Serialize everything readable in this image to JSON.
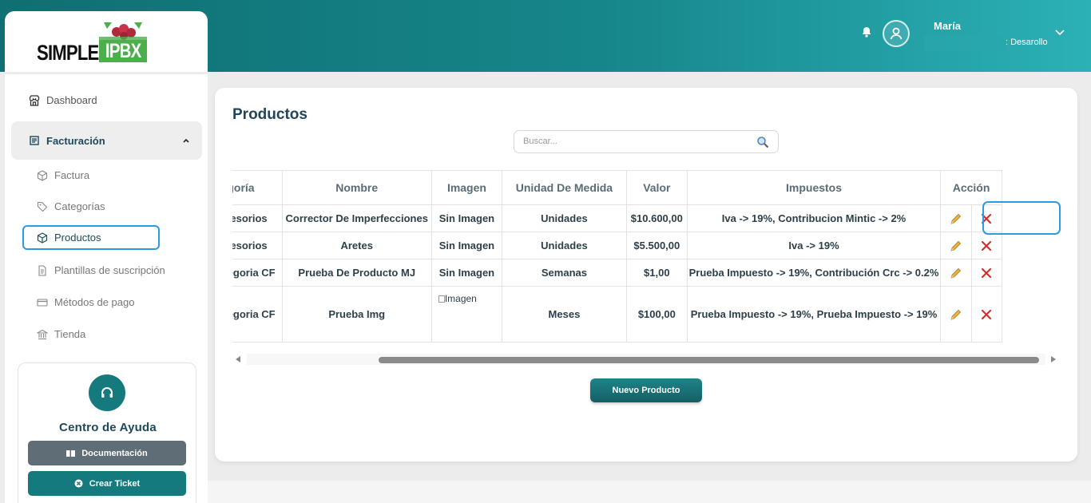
{
  "header": {
    "user_name": "María",
    "user_role": ": Desarollo"
  },
  "sidebar": {
    "logo_simple": "SIMPLE",
    "logo_ipbx": "IPBX",
    "dashboard": "Dashboard",
    "facturacion": "Facturación",
    "sub_items": {
      "factura": "Factura",
      "categorias": "Categorías",
      "productos": "Productos",
      "plantillas": "Plantillas de suscripción",
      "metodos": "Métodos de pago",
      "tienda": "Tienda"
    },
    "help": {
      "title": "Centro de Ayuda",
      "documentacion": "Documentación",
      "crear_ticket": "Crear Ticket"
    }
  },
  "main": {
    "title": "Productos",
    "search_placeholder": "Buscar...",
    "columns": [
      "Categoría",
      "Nombre",
      "Imagen",
      "Unidad De Medida",
      "Valor",
      "Impuestos",
      "Acción"
    ],
    "rows": [
      {
        "categoria": "Accesorios",
        "nombre": "Corrector De Imperfecciones",
        "imagen": "Sin Imagen",
        "unidad": "Unidades",
        "valor": "$10.600,00",
        "impuestos": "Iva -> 19%, Contribucion Mintic -> 2%"
      },
      {
        "categoria": "Accesorios",
        "nombre": "Aretes",
        "imagen": "Sin Imagen",
        "unidad": "Unidades",
        "valor": "$5.500,00",
        "impuestos": "Iva -> 19%"
      },
      {
        "categoria": "Categoria CF",
        "nombre": "Prueba De Producto MJ",
        "imagen": "Sin Imagen",
        "unidad": "Semanas",
        "valor": "$1,00",
        "impuestos": "Prueba Impuesto -> 19%, Contribución Crc -> 0.2%"
      },
      {
        "categoria": "Categoria CF",
        "nombre": "Prueba Img",
        "imagen": "Imagen",
        "unidad": "Meses",
        "valor": "$100,00",
        "impuestos": "Prueba Impuesto -> 19%, Prueba Impuesto -> 19%"
      }
    ],
    "new_button": "Nuevo Producto"
  },
  "colors": {
    "accent": "#157a7d",
    "highlight": "#2d9be0",
    "delete": "#d0312d"
  },
  "icons": {
    "edit": "pencil-icon",
    "delete": "close-icon"
  }
}
